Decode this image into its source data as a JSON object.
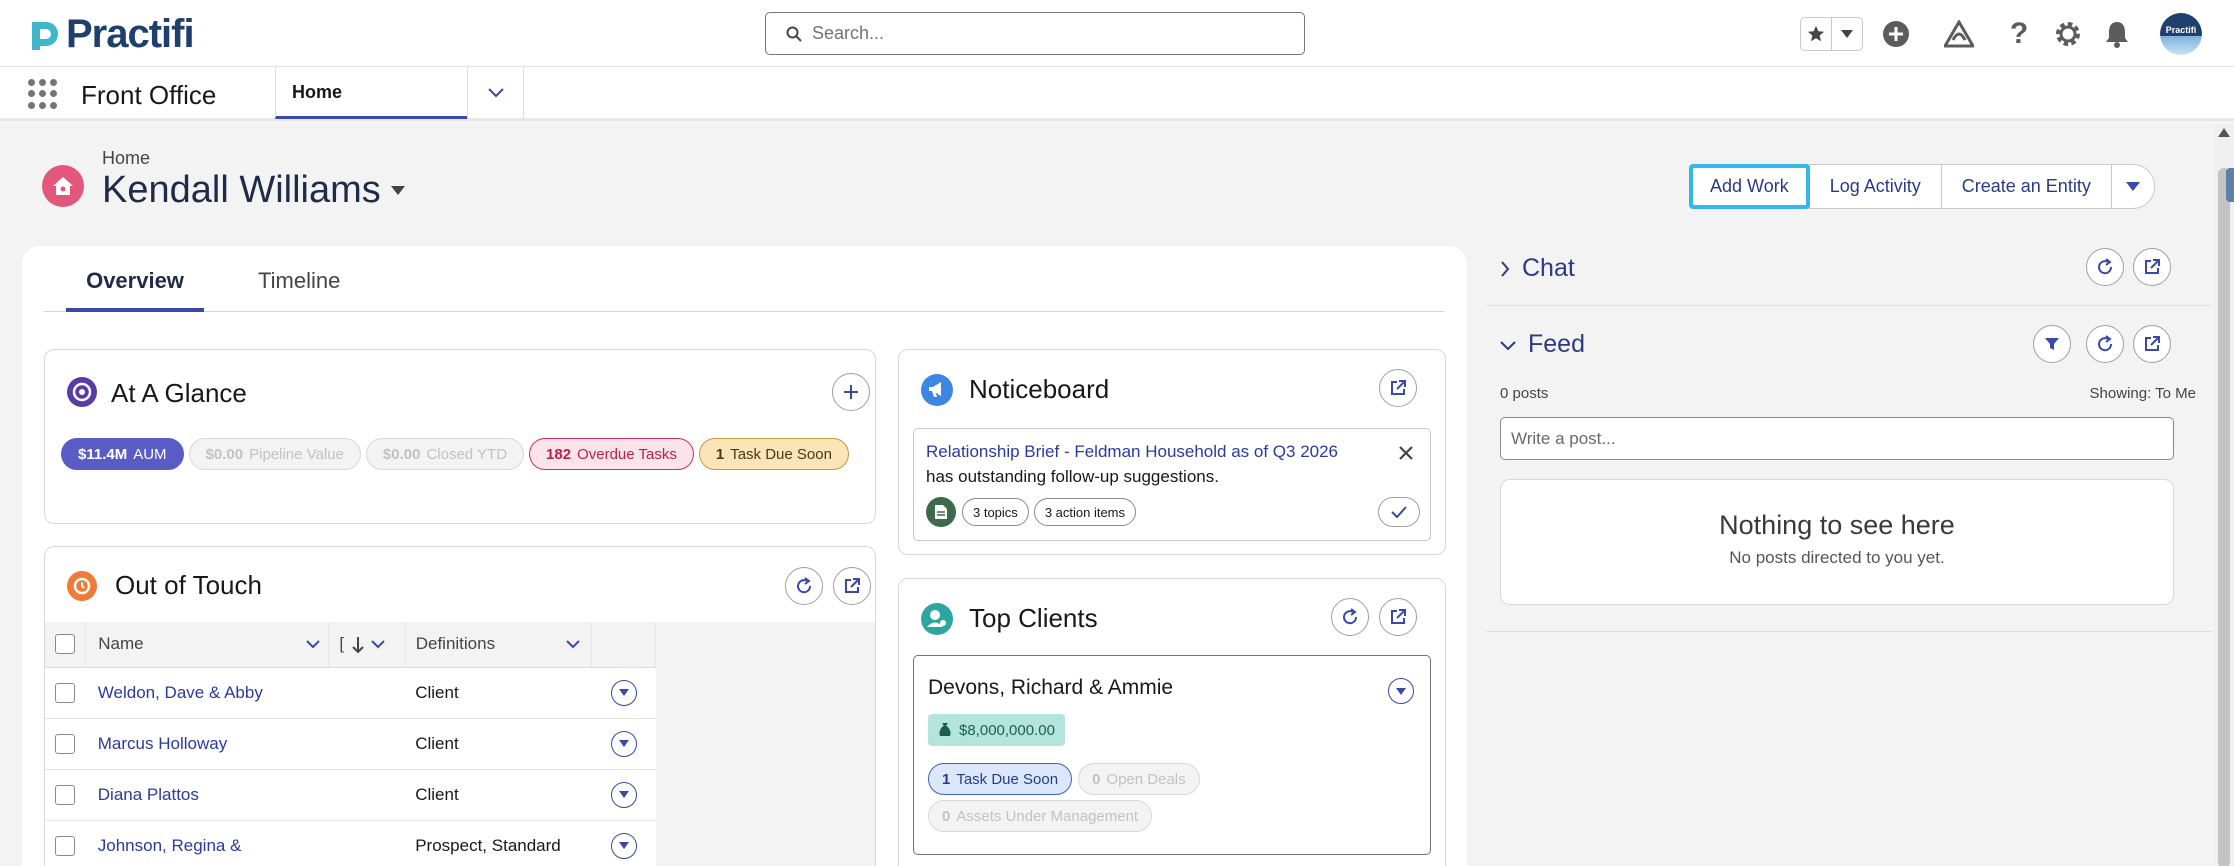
{
  "header": {
    "brand": "Practifi",
    "search_placeholder": "Search...",
    "avatar_text": "Practifi"
  },
  "nav": {
    "app_name": "Front Office",
    "tabs": [
      {
        "label": "Home"
      }
    ]
  },
  "page": {
    "breadcrumb": "Home",
    "title": "Kendall Williams",
    "actions": {
      "add_work": "Add Work",
      "log_activity": "Log Activity",
      "create_entity": "Create an Entity"
    }
  },
  "main": {
    "tabs": [
      {
        "label": "Overview"
      },
      {
        "label": "Timeline"
      }
    ],
    "at_a_glance": {
      "title": "At A Glance",
      "pills": [
        {
          "value": "$11.4M",
          "label": "AUM"
        },
        {
          "value": "$0.00",
          "label": "Pipeline Value"
        },
        {
          "value": "$0.00",
          "label": "Closed YTD"
        },
        {
          "value": "182",
          "label": "Overdue Tasks"
        },
        {
          "value": "1",
          "label": "Task Due Soon"
        }
      ]
    },
    "out_of_touch": {
      "title": "Out of Touch",
      "columns": [
        "Name",
        "[",
        "Definitions"
      ],
      "rows": [
        {
          "name": "Weldon, Dave & Abby",
          "definition": "Client"
        },
        {
          "name": "Marcus Holloway",
          "definition": "Client"
        },
        {
          "name": "Diana Plattos",
          "definition": "Client"
        },
        {
          "name": "Johnson, Regina &",
          "definition": "Prospect, Standard"
        }
      ]
    },
    "noticeboard": {
      "title": "Noticeboard",
      "item_title": "Relationship Brief - Feldman Household as of Q3 2026",
      "item_text": "has outstanding follow-up suggestions.",
      "chips": [
        "3 topics",
        "3 action items"
      ]
    },
    "top_clients": {
      "title": "Top Clients",
      "client_name": "Devons, Richard & Ammie",
      "aum": "$8,000,000.00",
      "pills": [
        {
          "value": "1",
          "label": "Task Due Soon"
        },
        {
          "value": "0",
          "label": "Open Deals"
        },
        {
          "value": "0",
          "label": "Assets Under Management"
        }
      ]
    }
  },
  "sidebar": {
    "chat_title": "Chat",
    "feed_title": "Feed",
    "posts_count": "0 posts",
    "showing": "Showing: To Me",
    "post_placeholder": "Write a post...",
    "empty_title": "Nothing to see here",
    "empty_subtitle": "No posts directed to you yet."
  },
  "colors": {
    "brand": "#1f3f6e",
    "accent": "#3a49a7",
    "highlight": "#34b8e8"
  }
}
